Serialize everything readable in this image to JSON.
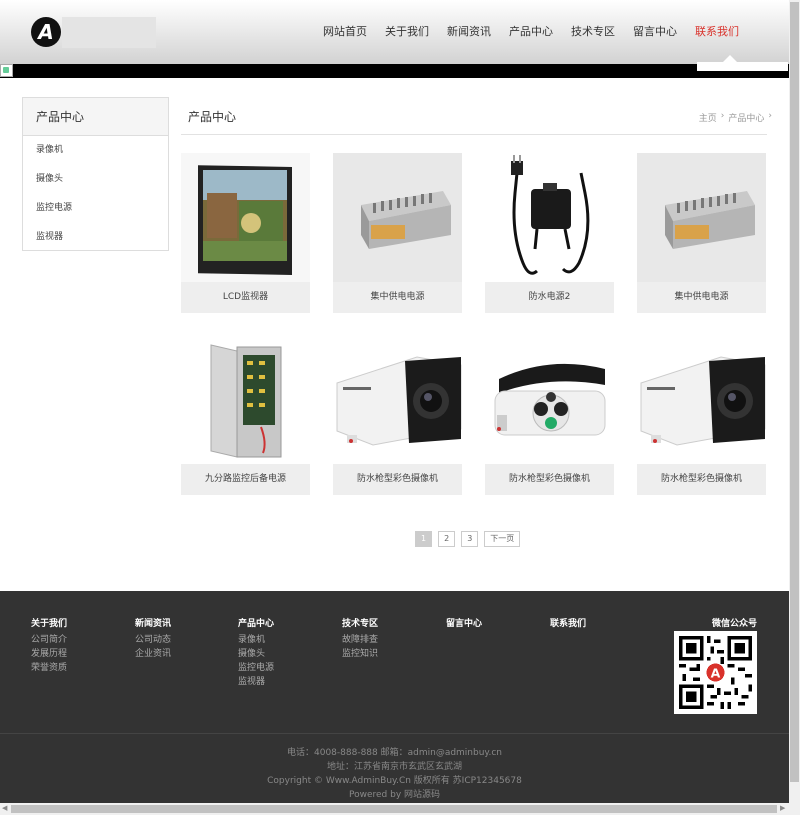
{
  "logo": {
    "letter": "A"
  },
  "nav": [
    {
      "label": "网站首页"
    },
    {
      "label": "关于我们"
    },
    {
      "label": "新闻资讯"
    },
    {
      "label": "产品中心"
    },
    {
      "label": "技术专区"
    },
    {
      "label": "留言中心"
    },
    {
      "label": "联系我们",
      "active": true
    }
  ],
  "sidebar": {
    "title": "产品中心",
    "items": [
      {
        "label": "录像机"
      },
      {
        "label": "摄像头"
      },
      {
        "label": "监控电源"
      },
      {
        "label": "监视器"
      }
    ]
  },
  "main": {
    "title": "产品中心",
    "breadcrumb": [
      {
        "label": "主页"
      },
      {
        "label": "产品中心"
      }
    ],
    "products": [
      {
        "name": "LCD监视器",
        "image": "monitor"
      },
      {
        "name": "集中供电电源",
        "image": "power-supply"
      },
      {
        "name": "防水电源2",
        "image": "adapter"
      },
      {
        "name": "集中供电电源",
        "image": "power-supply"
      },
      {
        "name": "九分路监控后备电源",
        "image": "cabinet"
      },
      {
        "name": "防水枪型彩色摄像机",
        "image": "bullet-camera"
      },
      {
        "name": "防水枪型彩色摄像机",
        "image": "bullet-camera-ir"
      },
      {
        "name": "防水枪型彩色摄像机",
        "image": "bullet-camera"
      }
    ]
  },
  "pagination": {
    "pages": [
      "1",
      "2",
      "3"
    ],
    "current": "1",
    "next_label": "下一页"
  },
  "footer": {
    "columns": [
      {
        "title": "关于我们",
        "links": [
          "公司简介",
          "发展历程",
          "荣誉资质"
        ]
      },
      {
        "title": "新闻资讯",
        "links": [
          "公司动态",
          "企业资讯"
        ]
      },
      {
        "title": "产品中心",
        "links": [
          "录像机",
          "摄像头",
          "监控电源",
          "监视器"
        ]
      },
      {
        "title": "技术专区",
        "links": [
          "故障排查",
          "监控知识"
        ]
      },
      {
        "title": "留言中心",
        "links": []
      },
      {
        "title": "联系我们",
        "links": []
      }
    ],
    "wechat_label": "微信公众号",
    "contact": "电话：4008-888-888 邮箱：admin@adminbuy.cn",
    "address": "地址：江苏省南京市玄武区玄武湖",
    "copyright": "Copyright © Www.AdminBuy.Cn 版权所有 苏ICP12345678",
    "powered": "Powered by 网站源码"
  },
  "colors": {
    "accent": "#d9322b",
    "footer_bg": "#333333",
    "caption_bg": "#eeeeee"
  }
}
